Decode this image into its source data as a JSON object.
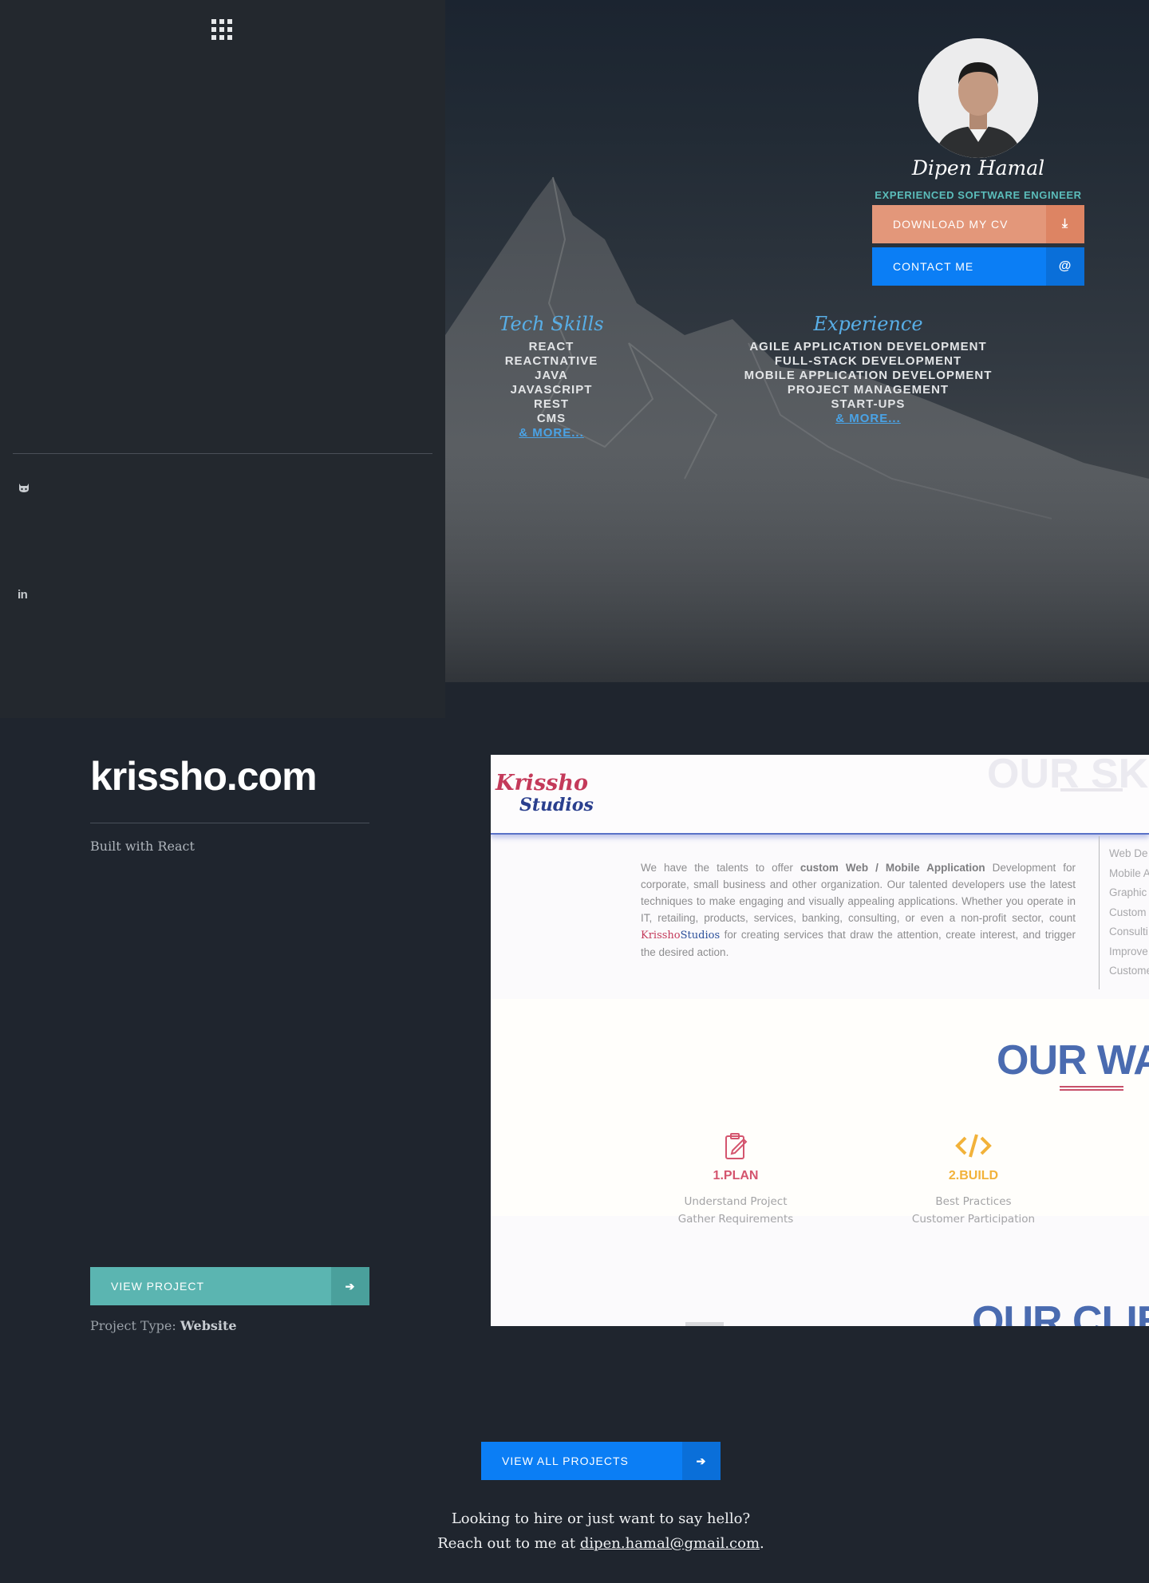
{
  "sidebar": {
    "menu_icon": "apps-grid-icon",
    "social": [
      {
        "icon": "github-icon",
        "glyph": "◕"
      },
      {
        "icon": "linkedin-icon",
        "glyph": "in"
      }
    ]
  },
  "hero": {
    "name": "Dipen Hamal",
    "role": "EXPERIENCED SOFTWARE ENGINEER",
    "cv_button": {
      "label": "DOWNLOAD MY CV",
      "icon": "download-icon",
      "glyph": "⤓"
    },
    "contact_button": {
      "label": "CONTACT ME",
      "icon": "at-icon",
      "glyph": "@"
    },
    "skills": {
      "heading": "Tech Skills",
      "items": [
        "REACT",
        "REACTNATIVE",
        "JAVA",
        "JAVASCRIPT",
        "REST",
        "CMS"
      ],
      "more": "& MORE..."
    },
    "experience": {
      "heading": "Experience",
      "items": [
        "AGILE APPLICATION DEVELOPMENT",
        "FULL-STACK DEVELOPMENT",
        "MOBILE APPLICATION DEVELOPMENT",
        "PROJECT MANAGEMENT",
        "START-UPS"
      ],
      "more": "& MORE..."
    }
  },
  "project": {
    "title": "krissho.com",
    "subtitle": "Built with React",
    "view_button": {
      "label": "VIEW PROJECT",
      "glyph": "➔"
    },
    "type_label": "Project Type:",
    "type_value": "Website",
    "preview": {
      "logo_line1": "Krissho",
      "logo_line2": "Studios",
      "ghost_heading": "OUR SKIL",
      "body_pre": "We have the talents to offer ",
      "body_bold": "custom Web / Mobile Application",
      "body_mid": " Development for corporate, small business and other organization. Our talented developers use the latest techniques to make engaging and visually appealing applications. Whether you operate in IT, retailing, products, services, banking, consulting, or even a non-profit sector, count ",
      "brand1": "Krissho",
      "brand2": "Studios",
      "body_post": " for creating services that draw the attention, create interest, and trigger the desired action.",
      "list": [
        "Web De",
        "Mobile A",
        "Graphic",
        "Custom",
        "Consulti",
        "Improve",
        "Custome"
      ],
      "way_heading": "OUR WAY",
      "steps": [
        {
          "title": "1.PLAN",
          "line1": "Understand Project",
          "line2": "Gather Requirements",
          "icon": "clipboard-edit-icon"
        },
        {
          "title": "2.BUILD",
          "line1": "Best Practices",
          "line2": "Customer Participation",
          "icon": "code-icon"
        }
      ],
      "clients_heading": "OUR CLIEN"
    }
  },
  "footer": {
    "all_button": {
      "label": "VIEW ALL PROJECTS",
      "glyph": "➔"
    },
    "hello_line1": "Looking to hire or just want to say hello?",
    "hello_pre": "Reach out to me at ",
    "email": "dipen.hamal@gmail.com",
    "hello_post": "."
  },
  "colors": {
    "page_bg": "#1f252e",
    "sidebar_bg": "#23282e",
    "teal": "#5bb5b1",
    "blue": "#0b7ef5",
    "salmon": "#e3977a",
    "script_blue": "#58aee6"
  }
}
